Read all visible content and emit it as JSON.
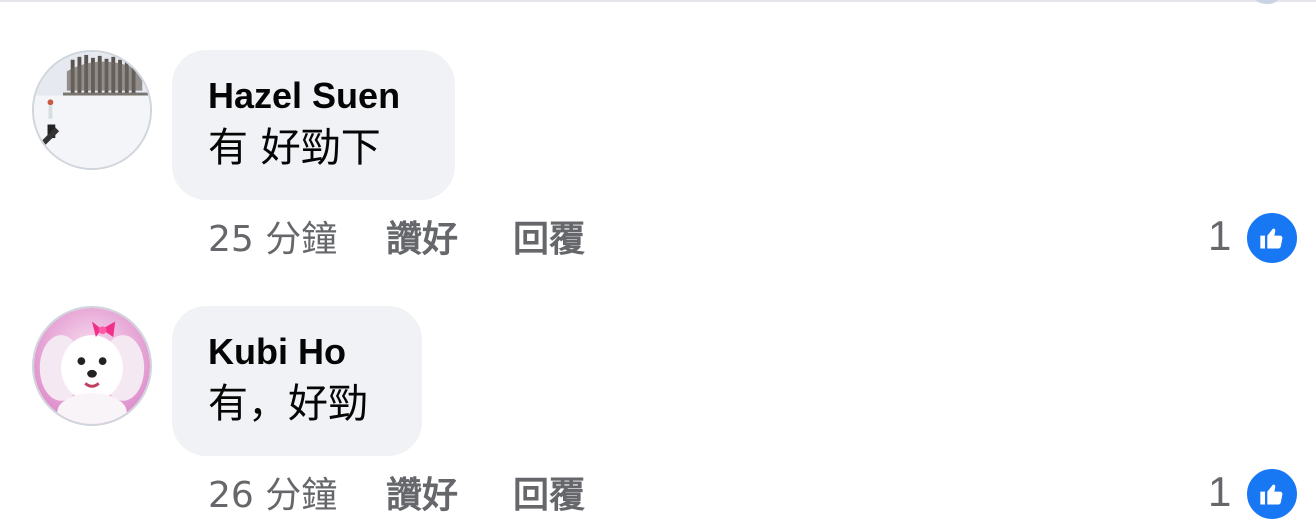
{
  "comments": [
    {
      "author": "Hazel Suen",
      "text": "有 好勁下",
      "time": "25 分鐘",
      "like_label": "讚好",
      "reply_label": "回覆",
      "reaction_count": "1",
      "avatar_icon": "snowy-field-avatar"
    },
    {
      "author": "Kubi Ho",
      "text": "有，好勁",
      "time": "26 分鐘",
      "like_label": "讚好",
      "reply_label": "回覆",
      "reaction_count": "1",
      "avatar_icon": "white-dog-avatar"
    }
  ],
  "colors": {
    "bubble": "#f0f2f5",
    "meta_text": "#65676b",
    "like_blue": "#1877f2"
  }
}
